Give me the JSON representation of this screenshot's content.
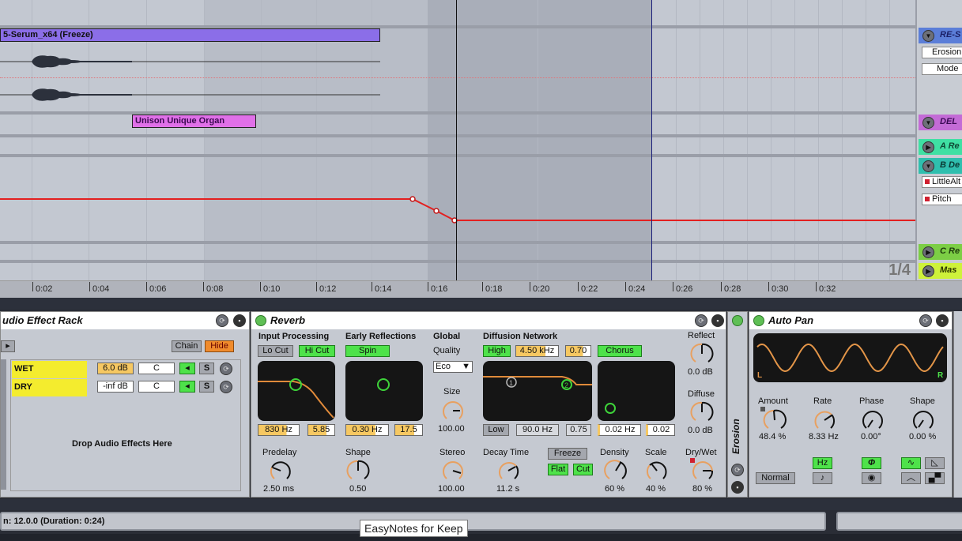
{
  "arrangement": {
    "clips": [
      {
        "name": "5-Serum_x64 (Freeze)",
        "color": "#8b6ee8"
      },
      {
        "name": "Unison Unique Organ",
        "color": "#e070e8"
      }
    ],
    "automation_color": "#e32020",
    "page_indicator": "1/4"
  },
  "tracks": [
    {
      "name": "RE-S",
      "color": "#5b7ed8",
      "params": [
        "Erosion",
        "Mode"
      ],
      "expanded": true
    },
    {
      "name": "DEL",
      "color": "#c36bd6",
      "params": [],
      "expanded": true
    },
    {
      "name": "A Re",
      "color": "#3fe0a3",
      "params": [],
      "expanded": false
    },
    {
      "name": "B De",
      "color": "#2fbfae",
      "params": [
        "LittleAlt",
        "Pitch"
      ],
      "expanded": true
    },
    {
      "name": "C Re",
      "color": "#7cce45",
      "params": [],
      "expanded": false
    },
    {
      "name": "Mas",
      "color": "#cef23a",
      "params": [],
      "expanded": false
    }
  ],
  "ruler": {
    "ticks": [
      "0:02",
      "0:04",
      "0:06",
      "0:08",
      "0:10",
      "0:12",
      "0:14",
      "0:16",
      "0:18",
      "0:20",
      "0:22",
      "0:24",
      "0:26",
      "0:28",
      "0:30",
      "0:32"
    ]
  },
  "rack": {
    "title": "udio Effect Rack",
    "chain_label": "Chain",
    "hide_label": "Hide",
    "chains": [
      {
        "name": "WET",
        "volume": "6.0 dB",
        "pan": "C",
        "solo": "S"
      },
      {
        "name": "DRY",
        "volume": "-inf dB",
        "pan": "C",
        "solo": "S"
      }
    ],
    "drop_hint": "Drop Audio Effects Here"
  },
  "reverb": {
    "title": "Reverb",
    "input_processing": {
      "label": "Input Processing",
      "lo_cut": "Lo Cut",
      "hi_cut": "Hi Cut",
      "freq": "830 Hz",
      "width": "5.85"
    },
    "early_reflections": {
      "label": "Early Reflections",
      "spin": "Spin",
      "rate": "0.30 Hz",
      "amount": "17.5"
    },
    "global": {
      "label": "Global",
      "quality_label": "Quality",
      "quality_value": "Eco",
      "size_label": "Size",
      "size_value": "100.00"
    },
    "diffusion": {
      "label": "Diffusion Network",
      "high": "High",
      "high_freq": "4.50 kHz",
      "high_val": "0.70",
      "chorus": "Chorus",
      "low": "Low",
      "low_freq": "90.0 Hz",
      "low_val": "0.75",
      "chorus_rate": "0.02 Hz",
      "chorus_amt": "0.02"
    },
    "reflect": {
      "label": "Reflect",
      "value": "0.0 dB"
    },
    "diffuse": {
      "label": "Diffuse",
      "value": "0.0 dB"
    },
    "predelay": {
      "label": "Predelay",
      "value": "2.50 ms"
    },
    "shape": {
      "label": "Shape",
      "value": "0.50"
    },
    "stereo": {
      "label": "Stereo",
      "value": "100.00"
    },
    "decay": {
      "label": "Decay Time",
      "value": "11.2 s"
    },
    "freeze": "Freeze",
    "flat": "Flat",
    "cut": "Cut",
    "density": {
      "label": "Density",
      "value": "60 %"
    },
    "scale": {
      "label": "Scale",
      "value": "40 %"
    },
    "drywet": {
      "label": "Dry/Wet",
      "value": "80 %"
    }
  },
  "erosion": {
    "title": "Erosion"
  },
  "autopan": {
    "title": "Auto Pan",
    "scope_left": "L",
    "scope_right": "R",
    "amount": {
      "label": "Amount",
      "value": "48.4 %"
    },
    "rate": {
      "label": "Rate",
      "value": "8.33 Hz"
    },
    "phase": {
      "label": "Phase",
      "value": "0.00°"
    },
    "shape": {
      "label": "Shape",
      "value": "0.00 %"
    },
    "normal": "Normal",
    "hz": "Hz",
    "note_icon": "♪",
    "phi": "Φ"
  },
  "status": {
    "text": "n: 12.0.0  (Duration: 0:24)"
  },
  "tooltip": "EasyNotes for Keep"
}
